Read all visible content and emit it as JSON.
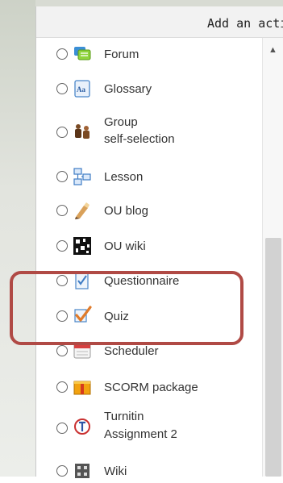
{
  "dialog": {
    "title": "Add an acti"
  },
  "activities": [
    {
      "label": "Forum",
      "icon": "forum-icon"
    },
    {
      "label": "Glossary",
      "icon": "glossary-icon"
    },
    {
      "label_line1": "Group",
      "label_line2": "self-selection",
      "icon": "group-people-icon"
    },
    {
      "label": "Lesson",
      "icon": "lesson-icon"
    },
    {
      "label": "OU blog",
      "icon": "blog-icon"
    },
    {
      "label": "OU wiki",
      "icon": "ou-wiki-icon"
    },
    {
      "label": "Questionnaire",
      "icon": "questionnaire-icon"
    },
    {
      "label": "Quiz",
      "icon": "quiz-checkmark-icon"
    },
    {
      "label": "Scheduler",
      "icon": "scheduler-icon"
    },
    {
      "label": "SCORM package",
      "icon": "scorm-package-icon"
    },
    {
      "label_line1": "Turnitin",
      "label_line2": "Assignment 2",
      "icon": "turnitin-icon"
    },
    {
      "label": "Wiki",
      "icon": "wiki-icon"
    }
  ],
  "colors": {
    "highlight_border": "#b04a45",
    "quiz_check": "#e07b2a"
  }
}
